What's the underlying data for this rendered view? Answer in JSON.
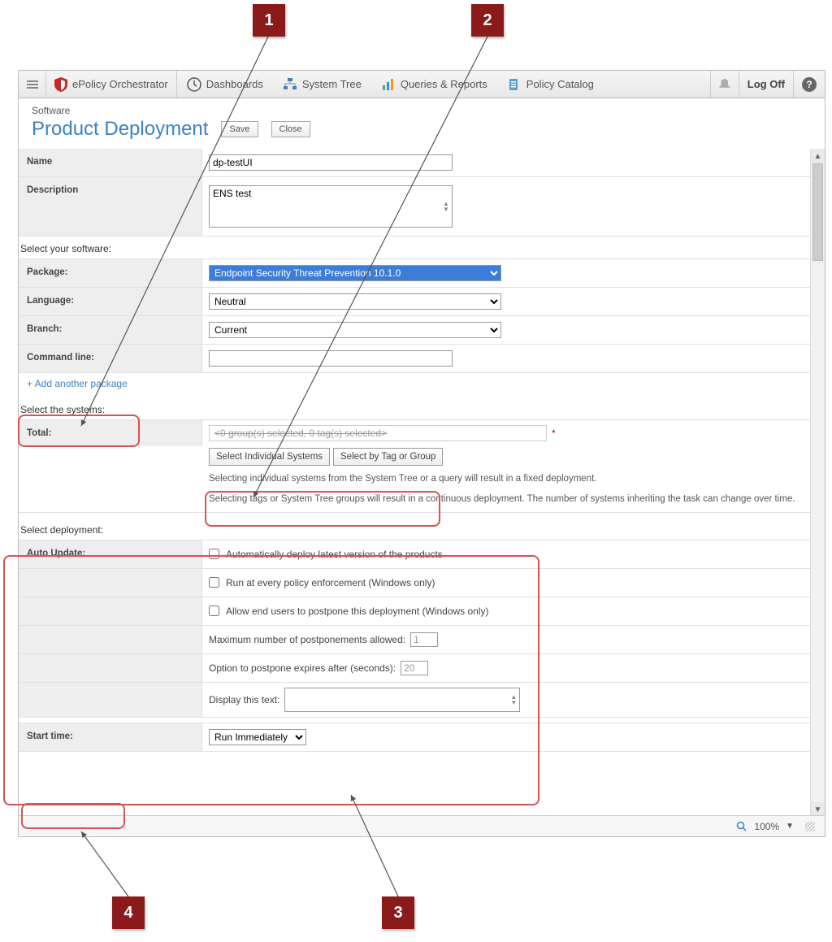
{
  "callouts": {
    "c1": "1",
    "c2": "2",
    "c3": "3",
    "c4": "4"
  },
  "topbar": {
    "brand": "ePolicy Orchestrator",
    "nav": {
      "dashboards": "Dashboards",
      "systemtree": "System Tree",
      "queries": "Queries & Reports",
      "policy": "Policy Catalog"
    },
    "logoff": "Log Off",
    "help_glyph": "?"
  },
  "page": {
    "breadcrumb": "Software",
    "title": "Product Deployment",
    "save": "Save",
    "close": "Close"
  },
  "form": {
    "name_label": "Name",
    "name_value": "dp-testUI",
    "desc_label": "Description",
    "desc_value": "ENS test",
    "software_heading": "Select your software:",
    "package_label": "Package:",
    "package_value": "Endpoint Security Threat Prevention 10.1.0",
    "language_label": "Language:",
    "language_value": "Neutral",
    "branch_label": "Branch:",
    "branch_value": "Current",
    "cmd_label": "Command line:",
    "cmd_value": "",
    "add_package": "+ Add another package",
    "systems_heading": "Select the systems:",
    "total_label": "Total:",
    "total_placeholder": "<0 group(s) selected, 0 tag(s) selected>",
    "btn_indiv": "Select Individual Systems",
    "btn_tag": "Select by Tag or Group",
    "helper1": "Selecting individual systems from the System Tree or a query will result in a fixed deployment.",
    "helper2": "Selecting tags or System Tree groups will result in a continuous deployment. The number of systems inheriting the task can change over time.",
    "deployment_heading": "Select deployment:",
    "auto_label": "Auto Update:",
    "auto_chk": "Automatically deploy latest version of the products",
    "run_chk": "Run at every policy enforcement (Windows only)",
    "allow_chk": "Allow end users to postpone this deployment (Windows only)",
    "max_post_label": "Maximum number of postponements allowed:",
    "max_post_value": "1",
    "expire_label": "Option to postpone expires after (seconds):",
    "expire_value": "20",
    "display_label": "Display this text:",
    "start_label": "Start time:",
    "start_value": "Run Immediately"
  },
  "statusbar": {
    "zoom": "100%"
  }
}
